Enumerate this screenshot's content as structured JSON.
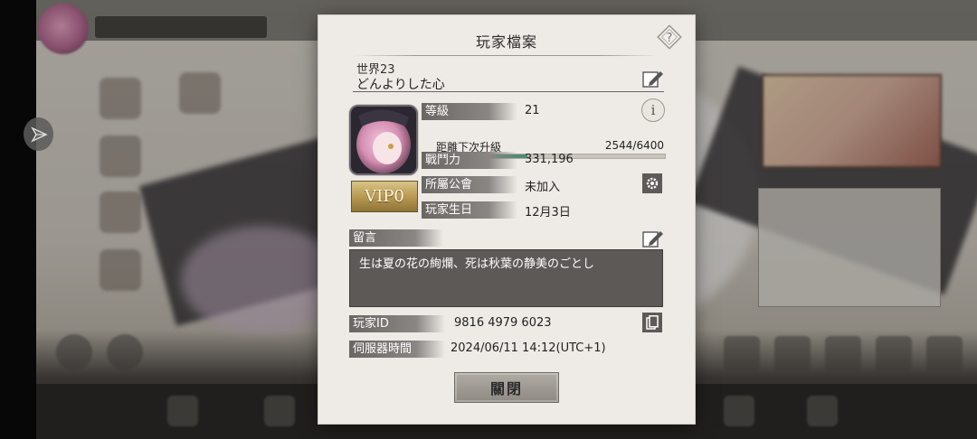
{
  "dialog": {
    "title": "玩家檔案",
    "server": "世界23",
    "player_name": "どんよりした心",
    "vip": "VIP0",
    "stats": {
      "level_label": "等級",
      "level_value": "21",
      "exp_label": "距離下次升級",
      "exp_value": "2544/6400",
      "exp_progress": 0.3975,
      "power_label": "戰鬥力",
      "power_value": "331,196",
      "guild_label": "所屬公會",
      "guild_value": "未加入",
      "birthday_label": "玩家生日",
      "birthday_value": "12月3日"
    },
    "message": {
      "label": "留言",
      "text": "生は夏の花の絢爛、死は秋葉の静美のごとし"
    },
    "player_id": {
      "label": "玩家ID",
      "value": "9816 4979 6023"
    },
    "server_time": {
      "label": "伺服器時間",
      "value": "2024/06/11 14:12(UTC+1)"
    },
    "close_label": "關閉"
  },
  "icons": {
    "help": "help-icon",
    "edit": "edit-icon",
    "info": "info-icon",
    "settings": "gear-icon",
    "copy": "copy-icon",
    "side": "triangle-toggle-icon"
  },
  "colors": {
    "dialog_bg": "#eeebe6",
    "label_bg": "#6a6664",
    "exp_fill": "#4f8a7a",
    "vip_gold": "#b89a52"
  }
}
